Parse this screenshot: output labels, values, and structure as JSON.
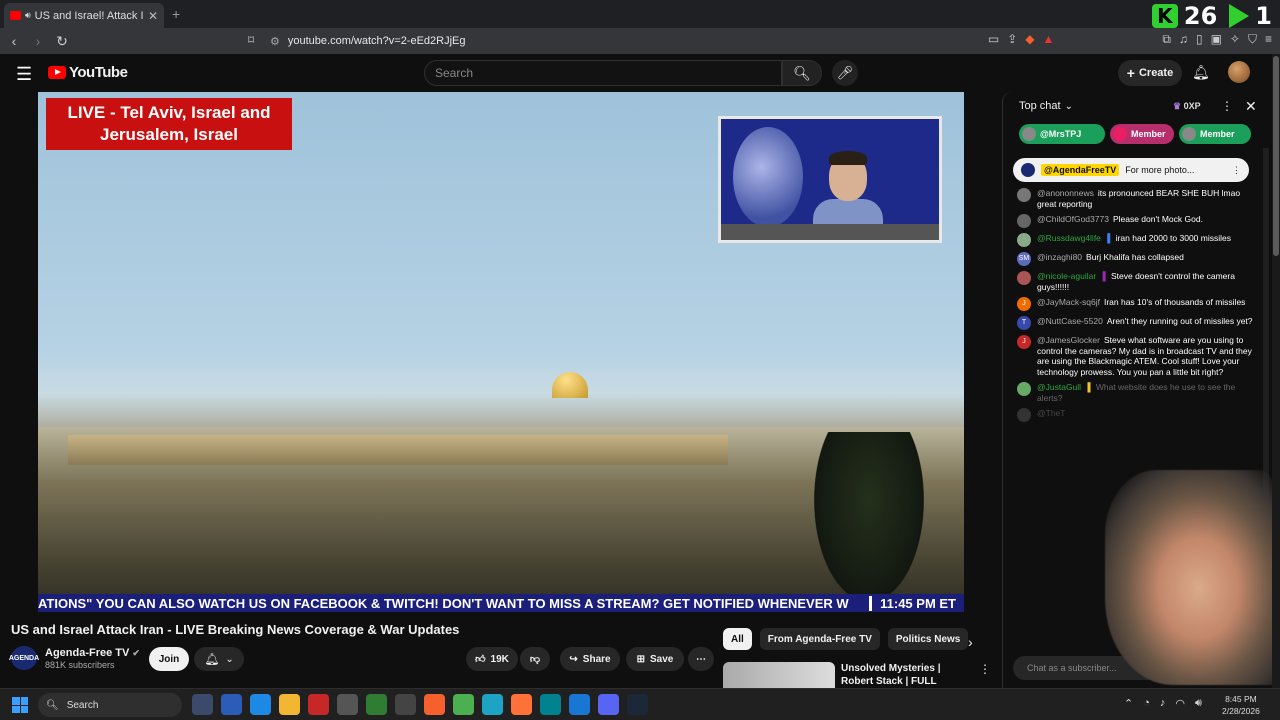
{
  "browser": {
    "tab_title": "US and Israel! Attack Iran - LIV",
    "url": "youtube.com/watch?v=2-eEd2RJjEg",
    "overlay_numbers": [
      "26",
      "1"
    ]
  },
  "header": {
    "logo_text": "YouTube",
    "search_placeholder": "Search",
    "create_label": "Create"
  },
  "player": {
    "location_banner": "LIVE - Tel Aviv, Israel and Jerusalem, Israel",
    "ticker_text": "ATIONS\"   YOU CAN ALSO WATCH US ON FACEBOOK & TWITCH!   DON'T WANT TO MISS A STREAM? GET NOTIFIED WHENEVER W",
    "ticker_time": "11:45 PM ET"
  },
  "video": {
    "title": "US and Israel Attack Iran - LIVE Breaking News Coverage & War Updates",
    "channel_name": "Agenda-Free TV",
    "channel_logo_text": "AGENDA",
    "subscribers": "881K subscribers",
    "join_label": "Join",
    "likes": "19K",
    "share_label": "Share",
    "save_label": "Save"
  },
  "chips": [
    "All",
    "From Agenda-Free TV",
    "Politics News"
  ],
  "recommended": {
    "title": "Unsolved Mysteries | Robert Stack | FULL EPISODES | ..."
  },
  "chat": {
    "header": "Top chat",
    "xp": "0XP",
    "ticker_items": [
      {
        "label": "@MrsTPJ",
        "color": "#1aa05a"
      },
      {
        "label": "Member",
        "color": "#b62e6b"
      },
      {
        "label": "Member",
        "color": "#1aa05a"
      }
    ],
    "pinned_author": "@AgendaFreeTV",
    "pinned_text": "For more photo...",
    "messages": [
      {
        "author": "@anononnews",
        "text": "its pronounced BEAR SHE BUH lmao great reporting",
        "member": false,
        "color": "#777"
      },
      {
        "author": "@ChildOfGod3773",
        "text": "Please don't Mock God.",
        "member": false,
        "color": "#666"
      },
      {
        "author": "@Russdawg4life",
        "text": "iran had 2000 to 3000 missiles",
        "member": true,
        "color": "#8a8"
      },
      {
        "author": "@inzaghi80",
        "text": "Burj Khalifa has collapsed",
        "member": false,
        "color": "#5c6bc0",
        "initial": "SM"
      },
      {
        "author": "@nicole-aguilar",
        "text": "Steve doesn't control the camera guys!!!!!!",
        "member": true,
        "color": "#a55"
      },
      {
        "author": "@JayMack-sq6jf",
        "text": "Iran has 10's of thousands of missiles",
        "member": false,
        "color": "#ef6c00",
        "initial": "J"
      },
      {
        "author": "@NuttCase-5520",
        "text": "Aren't they running out of missiles yet?",
        "member": false,
        "color": "#3949ab",
        "initial": "T"
      },
      {
        "author": "@JamesGlocker",
        "text": "Steve what software are you using to control the cameras? My dad is in broadcast TV and they are using the Blackmagic ATEM. Cool stuff! Love your technology prowess. You you pan a little bit right?",
        "member": false,
        "color": "#c62828",
        "initial": "J"
      },
      {
        "author": "@JustaGull",
        "text": "What website does he use to see the alerts?",
        "member": true,
        "color": "#6a6"
      },
      {
        "author": "@TheT",
        "text": "",
        "member": false,
        "color": "#777"
      }
    ],
    "input_placeholder": "Chat as a subscriber..."
  },
  "taskbar": {
    "search_label": "Search",
    "time": "8:45 PM",
    "date": "2/28/2026"
  }
}
